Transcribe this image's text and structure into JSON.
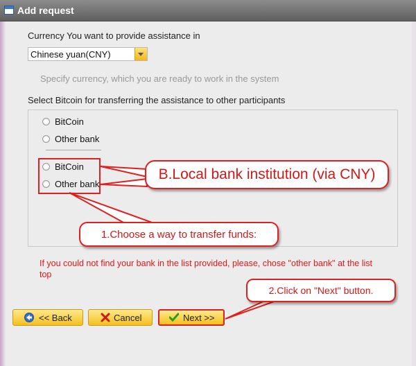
{
  "window": {
    "title": "Add request"
  },
  "currency": {
    "label": "Currency You want to provide assistance in",
    "selected": "Chinese yuan(CNY)",
    "hint": "Specify currency, which you are ready to work in the system"
  },
  "transfer": {
    "label": "Select Bitcoin for transferring the assistance to other participants",
    "options_group1": [
      "BitCoin",
      "Other bank"
    ],
    "options_group2": [
      "BitCoin",
      "Other bank"
    ]
  },
  "warning": "If you could not find your bank in the list provided, please, chose \"other bank\" at the list top",
  "annotations": {
    "bank_callout": "B.Local bank institution (via CNY)",
    "choose_callout": "1.Choose a way to transfer funds:",
    "next_callout": "2.Click on \"Next\" button."
  },
  "buttons": {
    "back": "<< Back",
    "cancel": "Cancel",
    "next": "Next >>"
  },
  "colors": {
    "annotation_red": "#e02020",
    "button_yellow": "#f5c01d",
    "warning_red": "#e01818"
  }
}
